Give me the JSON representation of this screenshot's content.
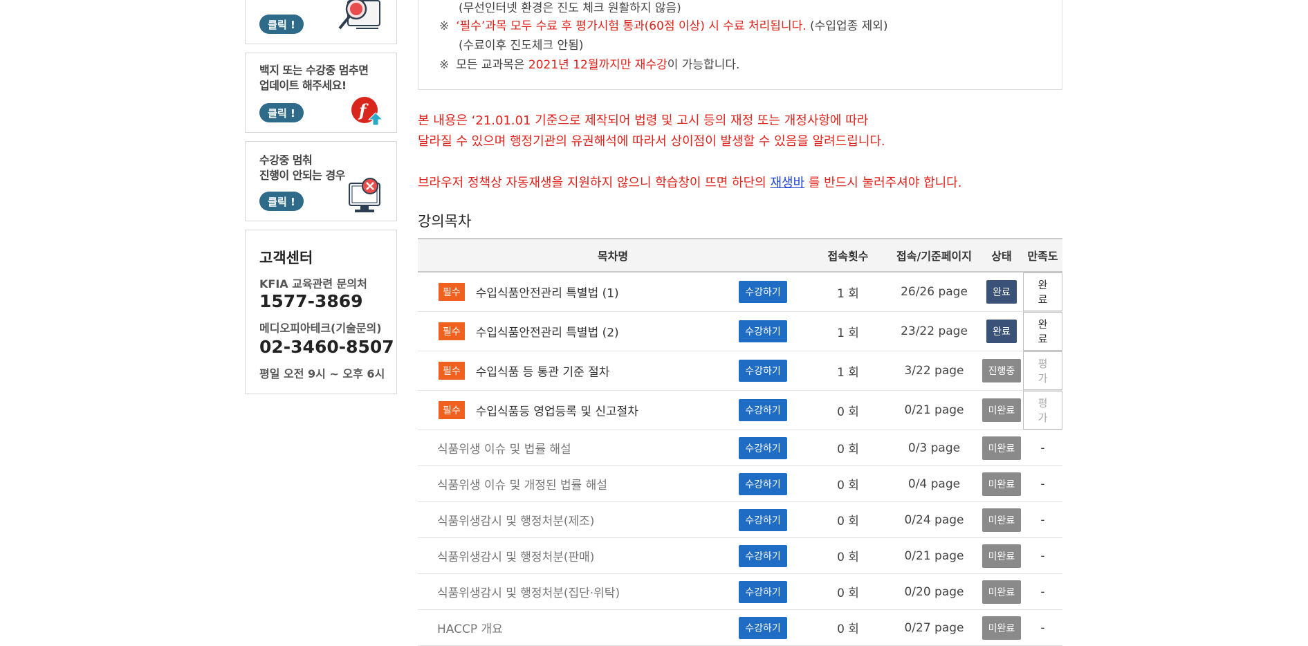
{
  "sidebar": {
    "top_banner": {
      "click_label": "클릭 !"
    },
    "flash_banner": {
      "line1": "백지 또는 수강중 멈추면",
      "line2": "업데이트 해주세요!",
      "click_label": "클릭 !"
    },
    "stuck_banner": {
      "line1": "수강중 멈춰",
      "line2": "진행이 안되는 경우",
      "click_label": "클릭 !"
    },
    "support": {
      "title": "고객센터",
      "edu_label": "KFIA 교육관련 문의처",
      "edu_phone": "1577-3869",
      "tech_label": "메디오피아테크(기술문의)",
      "tech_phone": "02-3460-8507",
      "hours": "평일 오전 9시 ~ 오후 6시"
    }
  },
  "notice": {
    "line0": "(무선인터넷 환경은 진도 체크 원활하지 않음)",
    "line1_red": "‘필수’과목 모두 수료 후 평가시험 통과(60점 이상) 시 수료 처리됩니다.",
    "line1_rest": " (수입업종 제외)",
    "line2": "(수료이후 진도체크 안됨)",
    "line3_a": "모든 교과목은 ",
    "line3_red": "2021년 12월까지만 재수강",
    "line3_b": "이 가능합니다.",
    "mark": "※"
  },
  "warnings": {
    "w1": "본 내용은 ‘21.01.01 기준으로 제작되어 법령 및 고시 등의 재정 또는 개정사항에 따라",
    "w2": "달라질 수 있으며 행정기관의 유권해석에 따라서 상이점이 발생할 수 있음을 알려드립니다.",
    "w3_a": "브라우저 정책상 자동재생을 지원하지 않으니 학습창이 뜨면 하단의 ",
    "w3_link": "재생바",
    "w3_b": " 를 반드시 눌러주셔야 합니다."
  },
  "section_title": "강의목차",
  "table": {
    "headers": [
      "목차명",
      "접속횟수",
      "접속/기준페이지",
      "상태",
      "만족도"
    ],
    "required_label": "필수",
    "study_label": "수강하기",
    "rows": [
      {
        "title": "수입식품안전관리 특별법 (1)",
        "required": true,
        "count": "1 회",
        "pages": "26/26 page",
        "status": "완료",
        "status_type": "done",
        "sat": "완료",
        "sat_type": "active"
      },
      {
        "title": "수입식품안전관리 특별법 (2)",
        "required": true,
        "count": "1 회",
        "pages": "23/22 page",
        "status": "완료",
        "status_type": "done",
        "sat": "완료",
        "sat_type": "active"
      },
      {
        "title": "수입식품 등 통관 기준 절차",
        "required": true,
        "count": "1 회",
        "pages": "3/22 page",
        "status": "진행중",
        "status_type": "prog",
        "sat": "평가",
        "sat_type": "muted"
      },
      {
        "title": "수입식품등 영업등록 및 신고절차",
        "required": true,
        "count": "0 회",
        "pages": "0/21 page",
        "status": "미완료",
        "status_type": "todo",
        "sat": "평가",
        "sat_type": "muted"
      },
      {
        "title": "식품위생 이슈 및 법률 해설",
        "required": false,
        "count": "0 회",
        "pages": "0/3 page",
        "status": "미완료",
        "status_type": "todo",
        "sat": "-",
        "sat_type": "dash"
      },
      {
        "title": "식품위생 이슈 및 개정된 법률 해설",
        "required": false,
        "count": "0 회",
        "pages": "0/4 page",
        "status": "미완료",
        "status_type": "todo",
        "sat": "-",
        "sat_type": "dash"
      },
      {
        "title": "식품위생감시 및 행정처분(제조)",
        "required": false,
        "count": "0 회",
        "pages": "0/24 page",
        "status": "미완료",
        "status_type": "todo",
        "sat": "-",
        "sat_type": "dash"
      },
      {
        "title": "식품위생감시 및 행정처분(판매)",
        "required": false,
        "count": "0 회",
        "pages": "0/21 page",
        "status": "미완료",
        "status_type": "todo",
        "sat": "-",
        "sat_type": "dash"
      },
      {
        "title": "식품위생감시 및 행정처분(집단·위탁)",
        "required": false,
        "count": "0 회",
        "pages": "0/20 page",
        "status": "미완료",
        "status_type": "todo",
        "sat": "-",
        "sat_type": "dash"
      },
      {
        "title": "HACCP 개요",
        "required": false,
        "count": "0 회",
        "pages": "0/27 page",
        "status": "미완료",
        "status_type": "todo",
        "sat": "-",
        "sat_type": "dash"
      }
    ]
  }
}
